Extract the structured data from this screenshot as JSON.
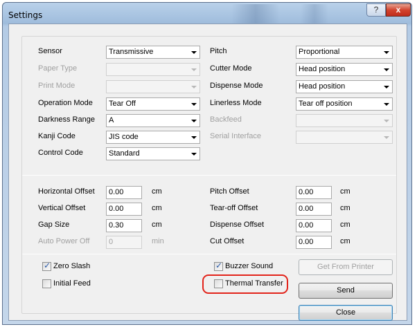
{
  "window": {
    "title": "Settings",
    "help_glyph": "?",
    "close_glyph": "x"
  },
  "printer_settings": {
    "sensor": {
      "label": "Sensor",
      "value": "Transmissive",
      "enabled": true
    },
    "paper_type": {
      "label": "Paper Type",
      "value": "",
      "enabled": false
    },
    "print_mode": {
      "label": "Print Mode",
      "value": "",
      "enabled": false
    },
    "operation_mode": {
      "label": "Operation Mode",
      "value": "Tear Off",
      "enabled": true
    },
    "darkness_range": {
      "label": "Darkness Range",
      "value": "A",
      "enabled": true
    },
    "kanji_code": {
      "label": "Kanji Code",
      "value": "JIS code",
      "enabled": true
    },
    "control_code": {
      "label": "Control Code",
      "value": "Standard",
      "enabled": true
    },
    "pitch": {
      "label": "Pitch",
      "value": "Proportional",
      "enabled": true
    },
    "cutter_mode": {
      "label": "Cutter Mode",
      "value": "Head position",
      "enabled": true
    },
    "dispense_mode": {
      "label": "Dispense Mode",
      "value": "Head position",
      "enabled": true
    },
    "linerless_mode": {
      "label": "Linerless Mode",
      "value": "Tear off position",
      "enabled": true
    },
    "backfeed": {
      "label": "Backfeed",
      "value": "",
      "enabled": false
    },
    "serial_interface": {
      "label": "Serial Interface",
      "value": "",
      "enabled": false
    }
  },
  "offsets": {
    "horizontal_offset": {
      "label": "Horizontal Offset",
      "value": "0.00",
      "unit": "cm"
    },
    "vertical_offset": {
      "label": "Vertical Offset",
      "value": "0.00",
      "unit": "cm"
    },
    "gap_size": {
      "label": "Gap Size",
      "value": "0.30",
      "unit": "cm"
    },
    "auto_power_off": {
      "label": "Auto Power Off",
      "value": "0",
      "unit": "min",
      "enabled": false
    },
    "pitch_offset": {
      "label": "Pitch Offset",
      "value": "0.00",
      "unit": "cm"
    },
    "tear_off_offset": {
      "label": "Tear-off Offset",
      "value": "0.00",
      "unit": "cm"
    },
    "dispense_offset": {
      "label": "Dispense Offset",
      "value": "0.00",
      "unit": "cm"
    },
    "cut_offset": {
      "label": "Cut Offset",
      "value": "0.00",
      "unit": "cm"
    }
  },
  "options": {
    "zero_slash": {
      "label": "Zero Slash",
      "checked": true
    },
    "initial_feed": {
      "label": "Initial Feed",
      "checked": false
    },
    "buzzer_sound": {
      "label": "Buzzer Sound",
      "checked": true
    },
    "thermal_transfer": {
      "label": "Thermal Transfer",
      "checked": false,
      "annotation_color": "#e2231a"
    }
  },
  "buttons": {
    "get_from_printer": {
      "label": "Get From Printer",
      "enabled": false
    },
    "send": {
      "label": "Send",
      "enabled": true
    },
    "close": {
      "label": "Close",
      "enabled": true
    }
  },
  "check_glyph": "✓"
}
